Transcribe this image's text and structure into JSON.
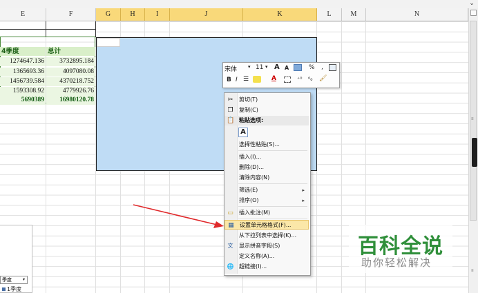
{
  "columns": [
    {
      "letter": "E",
      "selected": false
    },
    {
      "letter": "F",
      "selected": false
    },
    {
      "letter": "G",
      "selected": true
    },
    {
      "letter": "H",
      "selected": true
    },
    {
      "letter": "I",
      "selected": true
    },
    {
      "letter": "J",
      "selected": true
    },
    {
      "letter": "K",
      "selected": true
    },
    {
      "letter": "L",
      "selected": false
    },
    {
      "letter": "M",
      "selected": false
    },
    {
      "letter": "N",
      "selected": false
    }
  ],
  "table": {
    "headers": [
      "4季度",
      "总计"
    ],
    "rows": [
      [
        "1274647.136",
        "3732895.184"
      ],
      [
        "1365693.36",
        "4097080.08"
      ],
      [
        "1456739.584",
        "4370218.752"
      ],
      [
        "1593308.92",
        "4779926.76"
      ]
    ],
    "totals": [
      "5690389",
      "16980120.78"
    ]
  },
  "mini_toolbar": {
    "font_name": "宋体",
    "font_size": "11",
    "grow_font": "A",
    "shrink_font": "A",
    "percent": "%",
    "comma": ",",
    "bold": "B",
    "italic": "I",
    "font_color_letter": "A"
  },
  "context_menu": {
    "items": [
      {
        "label": "剪切(T)",
        "icon": "scissors-icon",
        "glyph": "✂"
      },
      {
        "label": "复制(C)",
        "icon": "copy-icon",
        "glyph": "❐"
      },
      {
        "label": "粘贴选项:",
        "icon": "paste-icon",
        "glyph": "📋"
      },
      {
        "label": "选择性粘贴(S)...",
        "icon": "",
        "glyph": ""
      },
      {
        "label": "插入(I)...",
        "icon": "",
        "glyph": ""
      },
      {
        "label": "删除(D)...",
        "icon": "",
        "glyph": ""
      },
      {
        "label": "清除内容(N)",
        "icon": "",
        "glyph": ""
      },
      {
        "label": "筛选(E)",
        "icon": "",
        "glyph": "",
        "submenu": true
      },
      {
        "label": "排序(O)",
        "icon": "",
        "glyph": "",
        "submenu": true
      },
      {
        "label": "插入批注(M)",
        "icon": "comment-icon",
        "glyph": "▭"
      },
      {
        "label": "设置单元格格式(F)...",
        "icon": "format-cells-icon",
        "glyph": "▦",
        "highlighted": true
      },
      {
        "label": "从下拉列表中选择(K)...",
        "icon": "",
        "glyph": ""
      },
      {
        "label": "显示拼音字段(S)",
        "icon": "phonetic-icon",
        "glyph": "文"
      },
      {
        "label": "定义名称(A)...",
        "icon": "",
        "glyph": ""
      },
      {
        "label": "超链接(I)...",
        "icon": "hyperlink-icon",
        "glyph": "🌐"
      }
    ],
    "paste_option_letter": "A"
  },
  "watermark": {
    "title": "百科全说",
    "subtitle": "助你轻松解决"
  },
  "pivot": {
    "dropdown_label": "季度",
    "item": "1季度"
  },
  "colors": {
    "selection_blue": "#bfdcf5",
    "header_selected": "#f9d97a",
    "table_green": "#ebf6e2",
    "watermark_green": "#2f8f3a",
    "arrow_red": "#e0292b",
    "menu_highlight": "#fbe7a8"
  }
}
